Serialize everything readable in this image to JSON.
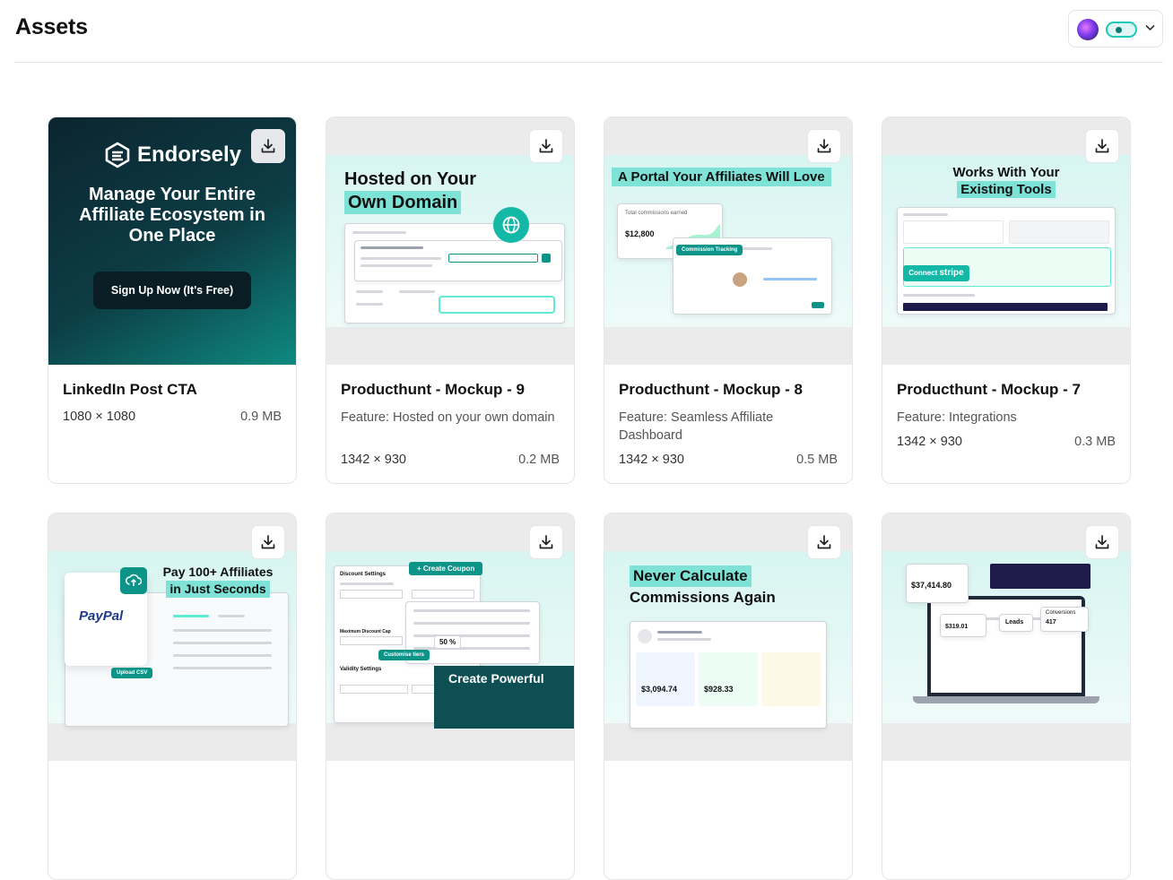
{
  "header": {
    "title": "Assets"
  },
  "cards": [
    {
      "title": "LinkedIn Post CTA",
      "description": "",
      "dims": "1080 × 1080",
      "size": "0.9 MB",
      "art": {
        "brand": "Endorsely",
        "headline": "Manage Your Entire Affiliate Ecosystem in One Place",
        "cta": "Sign Up Now (It's Free)"
      }
    },
    {
      "title": "Producthunt - Mockup - 9",
      "description": "Feature: Hosted on your own domain",
      "dims": "1342 × 930",
      "size": "0.2 MB",
      "art": {
        "headline1": "Hosted on Your",
        "headline2": "Own Domain"
      }
    },
    {
      "title": "Producthunt - Mockup - 8",
      "description": "Feature: Seamless Affiliate Dashboard",
      "dims": "1342 × 930",
      "size": "0.5 MB",
      "art": {
        "headline": "A Portal Your Affiliates Will Love",
        "stat_label": "Total commissions earned",
        "stat_value": "$12,800",
        "chip": "Commission Tracking"
      }
    },
    {
      "title": "Producthunt - Mockup - 7",
      "description": "Feature: Integrations",
      "dims": "1342 × 930",
      "size": "0.3 MB",
      "art": {
        "headline1": "Works With Your",
        "headline2": "Existing Tools",
        "connect": "Connect",
        "stripe": "stripe"
      }
    },
    {
      "title": "",
      "description": "",
      "dims": "",
      "size": "",
      "art": {
        "headline1": "Pay 100+ Affiliates",
        "headline2": "in Just Seconds",
        "paypal": "PayPal",
        "chip": "Upload CSV"
      }
    },
    {
      "title": "",
      "description": "",
      "dims": "",
      "size": "",
      "art": {
        "button": "+ Create Coupon",
        "label1": "Discount Settings",
        "label2": "Maximum Discount Cap",
        "label3": "Validity Settings",
        "chip": "Customise tiers",
        "pct": "50 %",
        "footer": "Create Powerful"
      }
    },
    {
      "title": "",
      "description": "",
      "dims": "",
      "size": "",
      "art": {
        "headline1": "Never Calculate",
        "headline2": "Commissions Again",
        "stat1": "$3,094.74",
        "stat2": "$928.33"
      }
    },
    {
      "title": "",
      "description": "",
      "dims": "",
      "size": "",
      "art": {
        "revenue": "$37,414.80",
        "aov": "$319.01",
        "leads": "Leads",
        "conversions": "Conversions",
        "conv_value": "417"
      }
    }
  ],
  "icons": {
    "download": "download-icon",
    "chevron": "chevron-down-icon"
  },
  "colors": {
    "accent": "#0d9488",
    "dark_teal": "#0b3b45",
    "highlight": "#7ee2d6"
  }
}
